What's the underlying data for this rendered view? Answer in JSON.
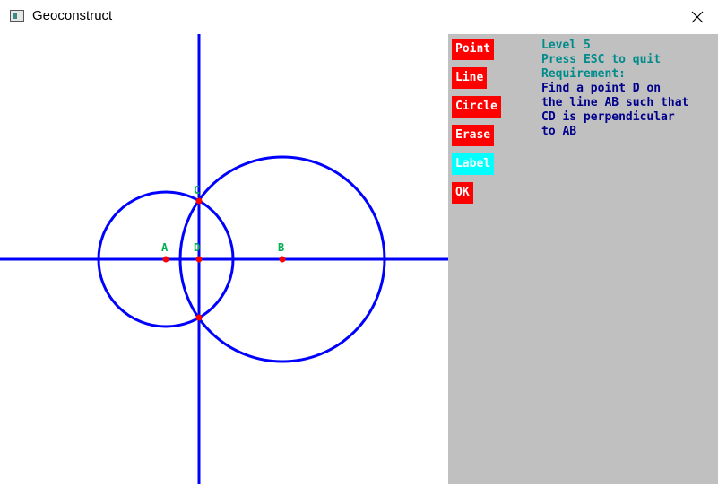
{
  "window": {
    "title": "Geoconstruct",
    "close_icon": "close-icon"
  },
  "tools": [
    {
      "label": "Point",
      "active": false
    },
    {
      "label": "Line",
      "active": false
    },
    {
      "label": "Circle",
      "active": false
    },
    {
      "label": "Erase",
      "active": false
    },
    {
      "label": "Label",
      "active": true
    },
    {
      "label": "OK",
      "active": false
    }
  ],
  "info": {
    "level": "Level 5",
    "quit_hint": "Press ESC to quit",
    "requirement_heading": "Requirement:",
    "requirement_lines": [
      "Find a point D on",
      "the line AB such that",
      "CD is perpendicular",
      "to AB"
    ]
  },
  "construction": {
    "points": [
      {
        "label": "A"
      },
      {
        "label": "D"
      },
      {
        "label": "B"
      },
      {
        "label": "C"
      }
    ],
    "colors": {
      "lines": "#0000ff",
      "points": "#ff0000",
      "labels": "#00b050",
      "panel": "#c0c0c0",
      "button": "#ff0000",
      "button_active": "#00ffff",
      "text_teal": "#008b8b",
      "text_navy": "#00008b"
    }
  }
}
